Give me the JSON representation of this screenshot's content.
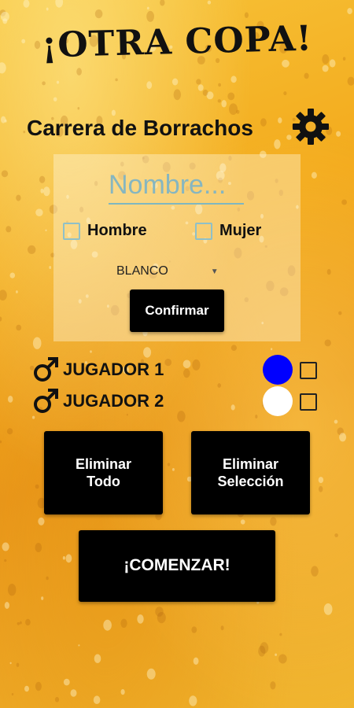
{
  "header": {
    "title": "¡OTRA COPA!",
    "subtitle": "Carrera de Borrachos",
    "settings_icon": "gear-icon"
  },
  "form": {
    "name_placeholder": "Nombre...",
    "name_value": "",
    "gender_options": [
      {
        "label": "Hombre",
        "checked": false
      },
      {
        "label": "Mujer",
        "checked": false
      }
    ],
    "color_select": {
      "selected": "BLANCO",
      "icon": "dropdown-caret-icon"
    },
    "confirm_label": "Confirmar"
  },
  "players": [
    {
      "label": "JUGADOR 1",
      "icon": "male-icon",
      "color": "#0000ff",
      "selected": false
    },
    {
      "label": "JUGADOR 2",
      "icon": "male-icon",
      "color": "#ffffff",
      "selected": false
    }
  ],
  "actions": {
    "delete_all_label": "Eliminar\nTodo",
    "delete_selected_label": "Eliminar\nSelección",
    "start_label": "¡COMENZAR!"
  },
  "colors": {
    "background": "#f3aa1c",
    "button_bg": "#000000",
    "checkbox_border": "#8fc0c8"
  }
}
